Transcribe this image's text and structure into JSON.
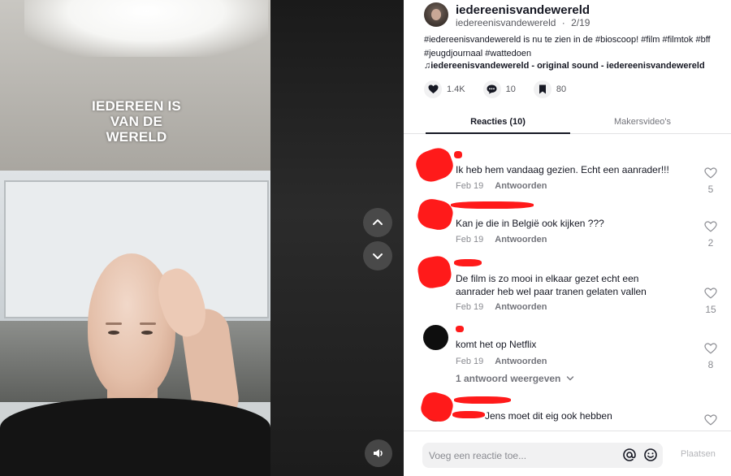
{
  "video": {
    "overlay_title": "IEDEREEN IS VAN DE WERELD",
    "nav_up_icon": "chevron-up-icon",
    "nav_down_icon": "chevron-down-icon",
    "volume_icon": "speaker-icon"
  },
  "post": {
    "username": "iedereenisvandewereld",
    "handle": "iedereenisvandewereld",
    "separator": "·",
    "date": "2/19",
    "caption": "#iedereenisvandewereld is nu te zien in de #bioscoop! #film #filmtok #bff #jeugdjournaal #wattedoen",
    "music": "iedereenisvandewereld - original sound - iedereenisvandewereld",
    "likes": "1.4K",
    "comments": "10",
    "saves": "80"
  },
  "tabs": {
    "reacties": "Reacties (10)",
    "makersvideos": "Makersvideo's"
  },
  "comments": [
    {
      "name": "",
      "text": "Ik heb hem vandaag gezien. Echt een aanrader!!!",
      "date": "Feb 19",
      "reply": "Antwoorden",
      "likes": "5"
    },
    {
      "name": "",
      "text": "Kan je die in België ook kijken ???",
      "date": "Feb 19",
      "reply": "Antwoorden",
      "likes": "2"
    },
    {
      "name": "",
      "text": "De film is zo mooi in elkaar gezet echt een aanrader heb wel paar tranen gelaten vallen",
      "date": "Feb 19",
      "reply": "Antwoorden",
      "likes": "15"
    },
    {
      "name": "",
      "text": "komt het op Netflix",
      "date": "Feb 19",
      "reply": "Antwoorden",
      "likes": "8",
      "more_replies": "1 antwoord weergeven"
    },
    {
      "name": "",
      "text": "Jens moet dit eig ook hebben",
      "date": "",
      "reply": "",
      "likes": ""
    }
  ],
  "footer": {
    "placeholder": "Voeg een reactie toe...",
    "post_label": "Plaatsen"
  },
  "colors": {
    "redaction": "#ff1a1a",
    "text_primary": "#161823",
    "text_secondary": "#8a8b91"
  }
}
